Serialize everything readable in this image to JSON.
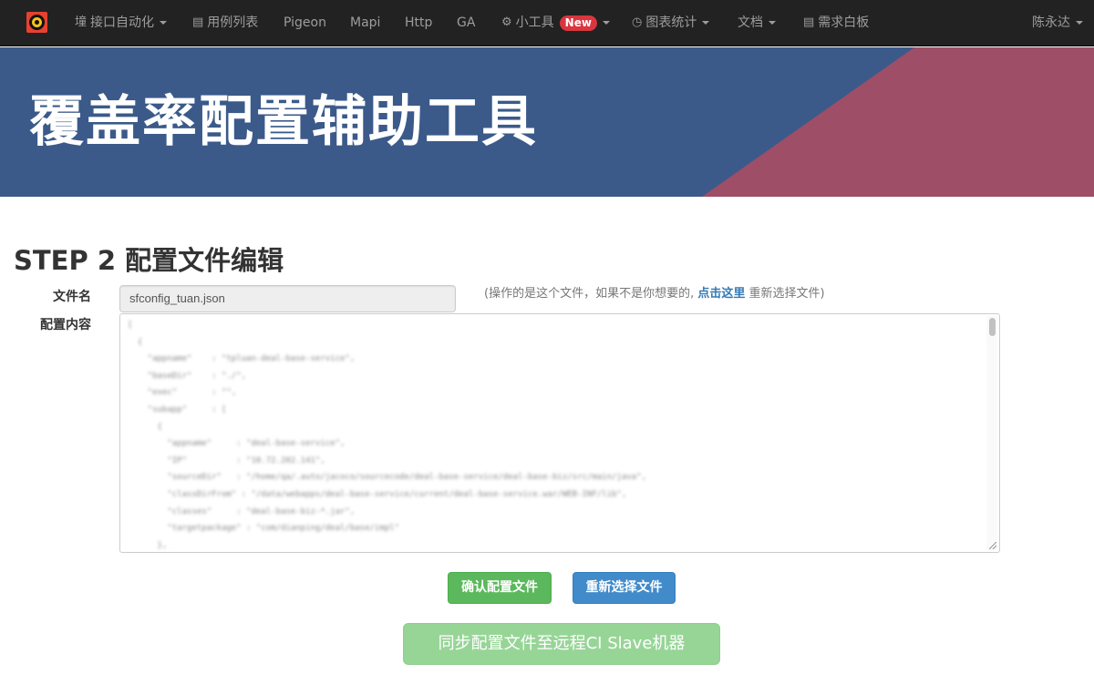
{
  "navbar": {
    "items": [
      {
        "icon": "barcode-icon",
        "glyph": "墥",
        "label": "接口自动化",
        "dropdown": true
      },
      {
        "icon": "list-icon",
        "glyph": "▤",
        "label": "用例列表",
        "dropdown": false
      },
      {
        "label": "Pigeon"
      },
      {
        "label": "Mapi"
      },
      {
        "label": "Http"
      },
      {
        "label": "GA"
      },
      {
        "icon": "gear-icon",
        "glyph": "⚙",
        "label": "小工具",
        "badge": "New",
        "dropdown": true
      },
      {
        "icon": "dashboard-icon",
        "glyph": "◷",
        "label": "图表统计",
        "dropdown": true
      },
      {
        "label": "文档",
        "dropdown": true
      },
      {
        "icon": "list-icon",
        "glyph": "▤",
        "label": "需求白板"
      }
    ],
    "user": "陈永达"
  },
  "banner": {
    "title": "覆盖率配置辅助工具",
    "color_left": "#3b5a8a",
    "color_right": "#9e4e66"
  },
  "step": {
    "title": "STEP 2 配置文件编辑"
  },
  "form": {
    "filename_label": "文件名",
    "filename_value": "sfconfig_tuan.json",
    "hint_prefix": "(操作的是这个文件，如果不是你想要的,",
    "hint_link": "点击这里",
    "hint_suffix": "重新选择文件)",
    "content_label": "配置内容",
    "content_lines": [
      "[",
      "  {",
      "    \"appname\"    : \"tpluan-deal-base-service\",",
      "    \"baseDir\"    : \"./\",",
      "    \"exec\"       : \"\",",
      "    \"subapp\"     : [",
      "      {",
      "        \"appname\"     : \"deal-base-service\",",
      "        \"IP\"          : \"10.72.202.141\",",
      "        \"sourceDir\"   : \"/home/qa/.auto/jacoco/sourcecode/deal-base-service/deal-base-biz/src/main/java\",",
      "        \"classDirFrom\" : \"/data/webapps/deal-base-service/current/deal-base-service.war/WEB-INF/lib\",",
      "        \"classes\"     : \"deal-base-biz-*.jar\",",
      "        \"targetpackage\" : \"com/dianping/deal/base/impl\"",
      "      },"
    ]
  },
  "buttons": {
    "confirm": "确认配置文件",
    "reselect": "重新选择文件",
    "sync": "同步配置文件至远程CI Slave机器"
  }
}
